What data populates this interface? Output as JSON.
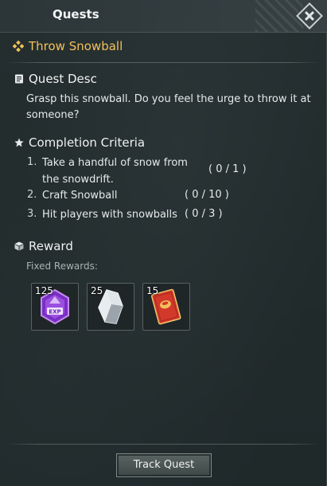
{
  "header": {
    "title": "Quests"
  },
  "quest": {
    "title": "Throw Snowball"
  },
  "description": {
    "heading": "Quest Desc",
    "text": "Grasp this snowball. Do you feel the urge to throw it at someone?"
  },
  "criteria": {
    "heading": "Completion Criteria",
    "items": [
      {
        "num": "1.",
        "text": "Take a handful of snow from the snowdrift.",
        "progress": "( 0 / 1 )"
      },
      {
        "num": "2.",
        "text": "Craft Snowball",
        "progress": "( 0 / 10 )"
      },
      {
        "num": "3.",
        "text": "Hit players with snowballs",
        "progress": "( 0 / 3 )"
      }
    ]
  },
  "reward": {
    "heading": "Reward",
    "fixed_label": "Fixed Rewards:",
    "items": [
      {
        "count": "125",
        "icon": "exp-crystal-icon"
      },
      {
        "count": "25",
        "icon": "silver-crystal-icon"
      },
      {
        "count": "15",
        "icon": "red-envelope-icon"
      }
    ]
  },
  "footer": {
    "track_label": "Track Quest"
  },
  "colors": {
    "quest_title": "#f2c15a",
    "accent_purple": "#8e44d8",
    "accent_red": "#d2392b"
  }
}
